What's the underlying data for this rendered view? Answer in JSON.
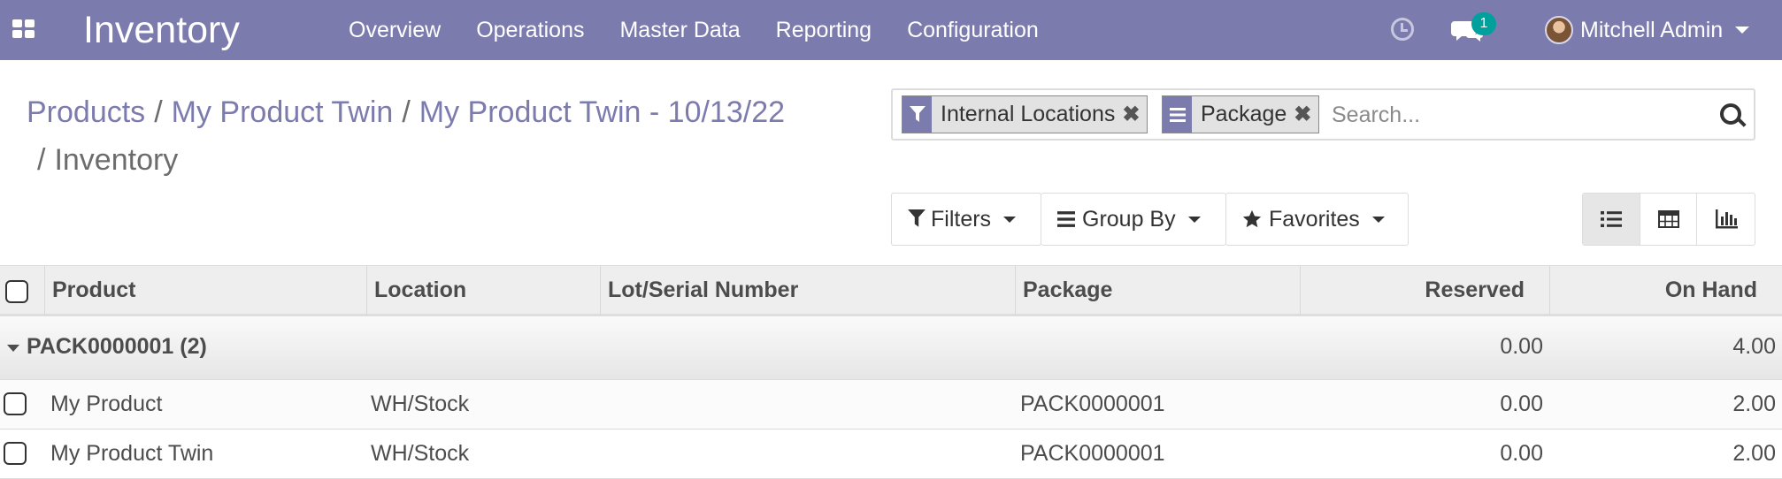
{
  "navbar": {
    "app_name": "Inventory",
    "menu": [
      "Overview",
      "Operations",
      "Master Data",
      "Reporting",
      "Configuration"
    ],
    "chat_count": "1",
    "user_name": "Mitchell Admin",
    "accent_color": "#7c7bad"
  },
  "breadcrumb": {
    "items": [
      "Products",
      "My Product Twin",
      "My Product Twin - 10/13/22"
    ],
    "separator": "/",
    "active": "Inventory"
  },
  "search": {
    "facets": [
      {
        "icon": "filter-icon",
        "label": "Internal Locations"
      },
      {
        "icon": "group-by-icon",
        "label": "Package"
      }
    ],
    "remove_glyph": "✖",
    "placeholder": "Search..."
  },
  "controls": {
    "filters_label": "Filters",
    "group_by_label": "Group By",
    "favorites_label": "Favorites",
    "views": [
      "list-view-icon",
      "pivot-view-icon",
      "graph-view-icon"
    ],
    "active_view": "list-view-icon"
  },
  "table": {
    "columns": [
      "Product",
      "Location",
      "Lot/Serial Number",
      "Package",
      "Reserved",
      "On Hand"
    ],
    "groups": [
      {
        "name": "PACK0000001 (2)",
        "reserved": "0.00",
        "on_hand": "4.00",
        "rows": [
          {
            "product": "My Product",
            "location": "WH/Stock",
            "lot": "",
            "package": "PACK0000001",
            "reserved": "0.00",
            "on_hand": "2.00"
          },
          {
            "product": "My Product Twin",
            "location": "WH/Stock",
            "lot": "",
            "package": "PACK0000001",
            "reserved": "0.00",
            "on_hand": "2.00"
          }
        ]
      }
    ]
  }
}
